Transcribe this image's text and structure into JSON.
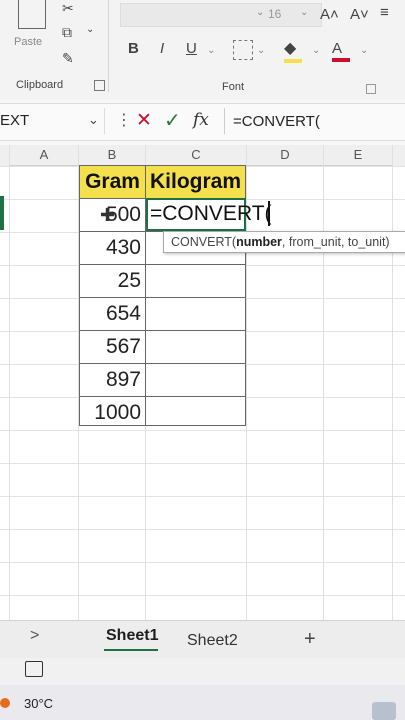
{
  "ribbon": {
    "font_size": "16",
    "grow_font": "A˄",
    "shrink_font": "A˅",
    "paste_label": "Paste",
    "bold": "B",
    "italic": "I",
    "underline": "U",
    "clipboard_label": "Clipboard",
    "font_label": "Font"
  },
  "formula_bar": {
    "name_box": "EXT",
    "cancel_icon": "✕",
    "enter_icon": "✓",
    "fx": "fx",
    "content": "=CONVERT("
  },
  "columns": [
    "A",
    "B",
    "C",
    "D",
    "E"
  ],
  "table": {
    "headers": [
      "Gram",
      "Kilogram"
    ],
    "grams": [
      "500",
      "430",
      "25",
      "654",
      "567",
      "897",
      "1000"
    ]
  },
  "active_cell_text": "=CONVERT(",
  "tooltip": {
    "fn": "CONVERT(",
    "arg1": "number",
    "rest": ", from_unit, to_unit)"
  },
  "tabs": {
    "nav": ">",
    "sheet1": "Sheet1",
    "sheet2": "Sheet2",
    "add": "+"
  },
  "taskbar": {
    "temperature": "30°C"
  },
  "colors": {
    "header_fill": "#f4e04d",
    "active_border": "#1e7145",
    "cancel_red": "#c8102e"
  }
}
